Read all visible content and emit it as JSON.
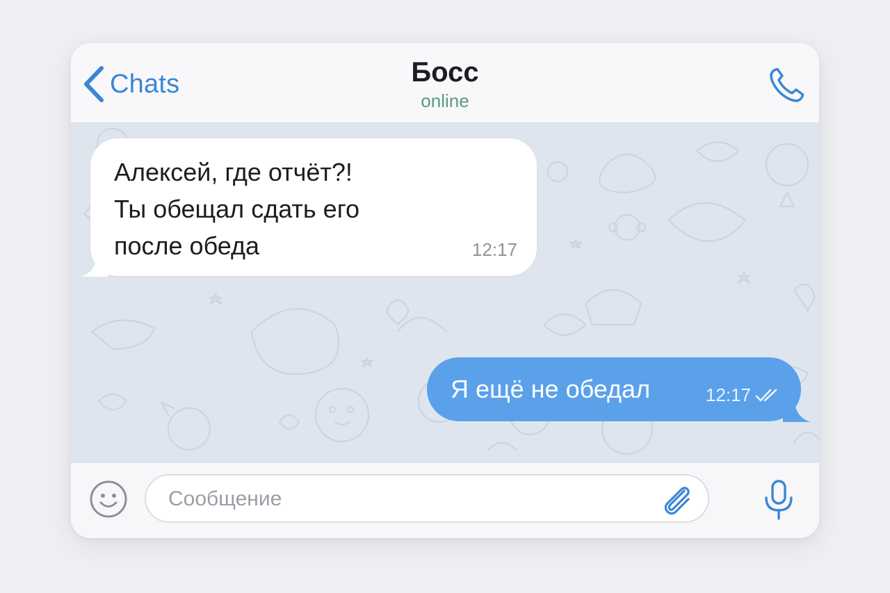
{
  "header": {
    "back_label": "Chats",
    "title": "Босс",
    "status": "online"
  },
  "messages": [
    {
      "direction": "incoming",
      "lines": [
        "Алексей, где отчёт?!",
        "Ты обещал сдать его",
        "после обеда"
      ],
      "time": "12:17"
    },
    {
      "direction": "outgoing",
      "text": "Я ещё не обедал",
      "time": "12:17",
      "read_status": "double-check-icon"
    }
  ],
  "composer": {
    "placeholder": "Сообщение",
    "value": ""
  },
  "icons": {
    "back": "chevron-left-icon",
    "call": "phone-icon",
    "emoji": "smile-icon",
    "attach": "paperclip-icon",
    "voice": "microphone-icon"
  },
  "colors": {
    "accent": "#3a86d6",
    "outgoing_bubble": "#5aa1ea",
    "online_status": "#5c9a78",
    "chat_background": "#dfe5ee"
  }
}
